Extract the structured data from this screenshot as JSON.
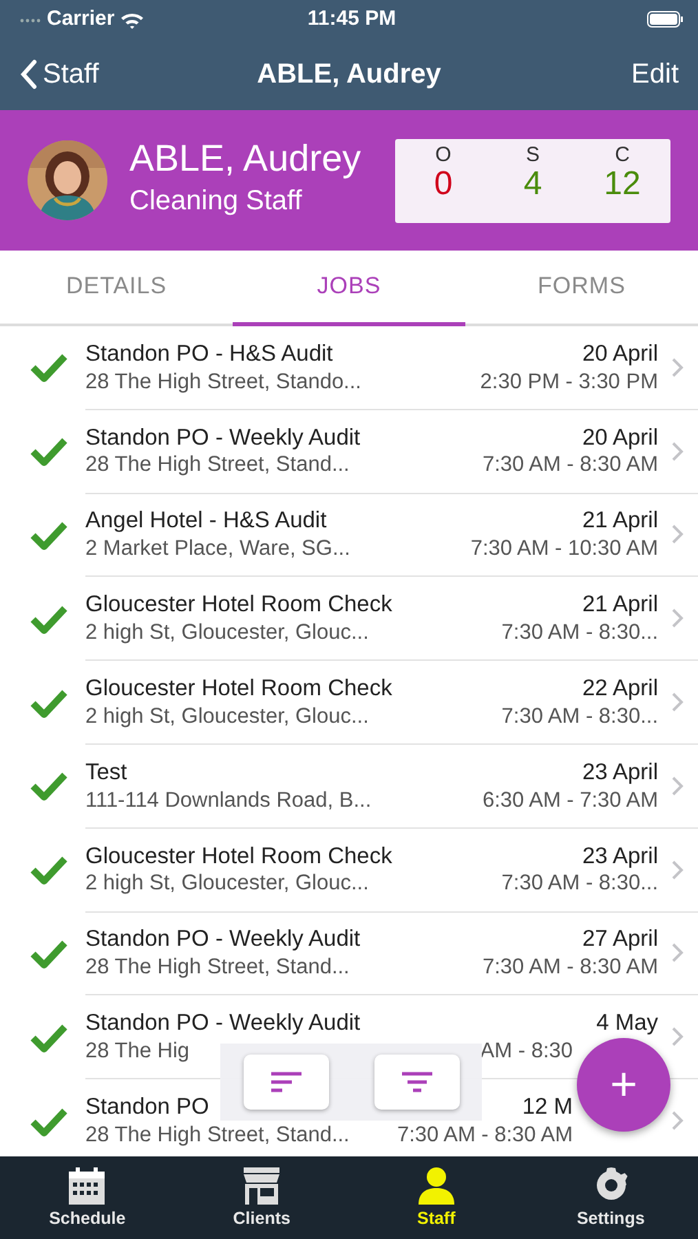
{
  "status_bar": {
    "carrier": "Carrier",
    "time": "11:45 PM"
  },
  "nav": {
    "back": "Staff",
    "title": "ABLE, Audrey",
    "action": "Edit"
  },
  "profile": {
    "name": "ABLE, Audrey",
    "role": "Cleaning Staff",
    "counts": [
      {
        "label": "O",
        "value": "0",
        "color": "#d0021b"
      },
      {
        "label": "S",
        "value": "4",
        "color": "#4a8c0c"
      },
      {
        "label": "C",
        "value": "12",
        "color": "#4a8c0c"
      }
    ]
  },
  "tabs": [
    {
      "label": "DETAILS",
      "selected": false
    },
    {
      "label": "JOBS",
      "selected": true
    },
    {
      "label": "FORMS",
      "selected": false
    }
  ],
  "jobs": [
    {
      "title": "Standon PO - H&S Audit",
      "address": "28 The High Street, Stando...",
      "date": "20 April",
      "time": "2:30 PM - 3:30 PM",
      "done": true
    },
    {
      "title": "Standon PO - Weekly Audit",
      "address": "28 The High Street, Stand...",
      "date": "20 April",
      "time": "7:30 AM - 8:30 AM",
      "done": true
    },
    {
      "title": "Angel Hotel - H&S Audit",
      "address": "2 Market Place, Ware, SG...",
      "date": "21 April",
      "time": "7:30 AM - 10:30 AM",
      "done": true
    },
    {
      "title": "Gloucester Hotel Room Check",
      "address": "2 high St, Gloucester, Glouc...",
      "date": "21 April",
      "time": "7:30 AM - 8:30...",
      "done": true
    },
    {
      "title": "Gloucester Hotel Room Check",
      "address": "2 high St, Gloucester, Glouc...",
      "date": "22 April",
      "time": "7:30 AM - 8:30...",
      "done": true
    },
    {
      "title": "Test",
      "address": "111-114 Downlands Road, B...",
      "date": "23 April",
      "time": "6:30 AM - 7:30 AM",
      "done": true
    },
    {
      "title": "Gloucester Hotel Room Check",
      "address": "2 high St, Gloucester, Glouc...",
      "date": "23 April",
      "time": "7:30 AM - 8:30...",
      "done": true
    },
    {
      "title": "Standon PO - Weekly Audit",
      "address": "28 The High Street, Stand...",
      "date": "27 April",
      "time": "7:30 AM - 8:30 AM",
      "done": true
    },
    {
      "title": "Standon PO - Weekly Audit",
      "address": "28 The Hig",
      "date": "4 May",
      "time": "AM - 8:30",
      "done": true
    },
    {
      "title": "Standon PO",
      "address": "28 The High Street, Stand...",
      "date": "12 M",
      "time": "7:30 AM - 8:30 AM",
      "done": true
    }
  ],
  "bottom_tabs": [
    {
      "label": "Schedule",
      "selected": false
    },
    {
      "label": "Clients",
      "selected": false
    },
    {
      "label": "Staff",
      "selected": true
    },
    {
      "label": "Settings",
      "selected": false
    }
  ],
  "fab": {
    "label": "+"
  }
}
